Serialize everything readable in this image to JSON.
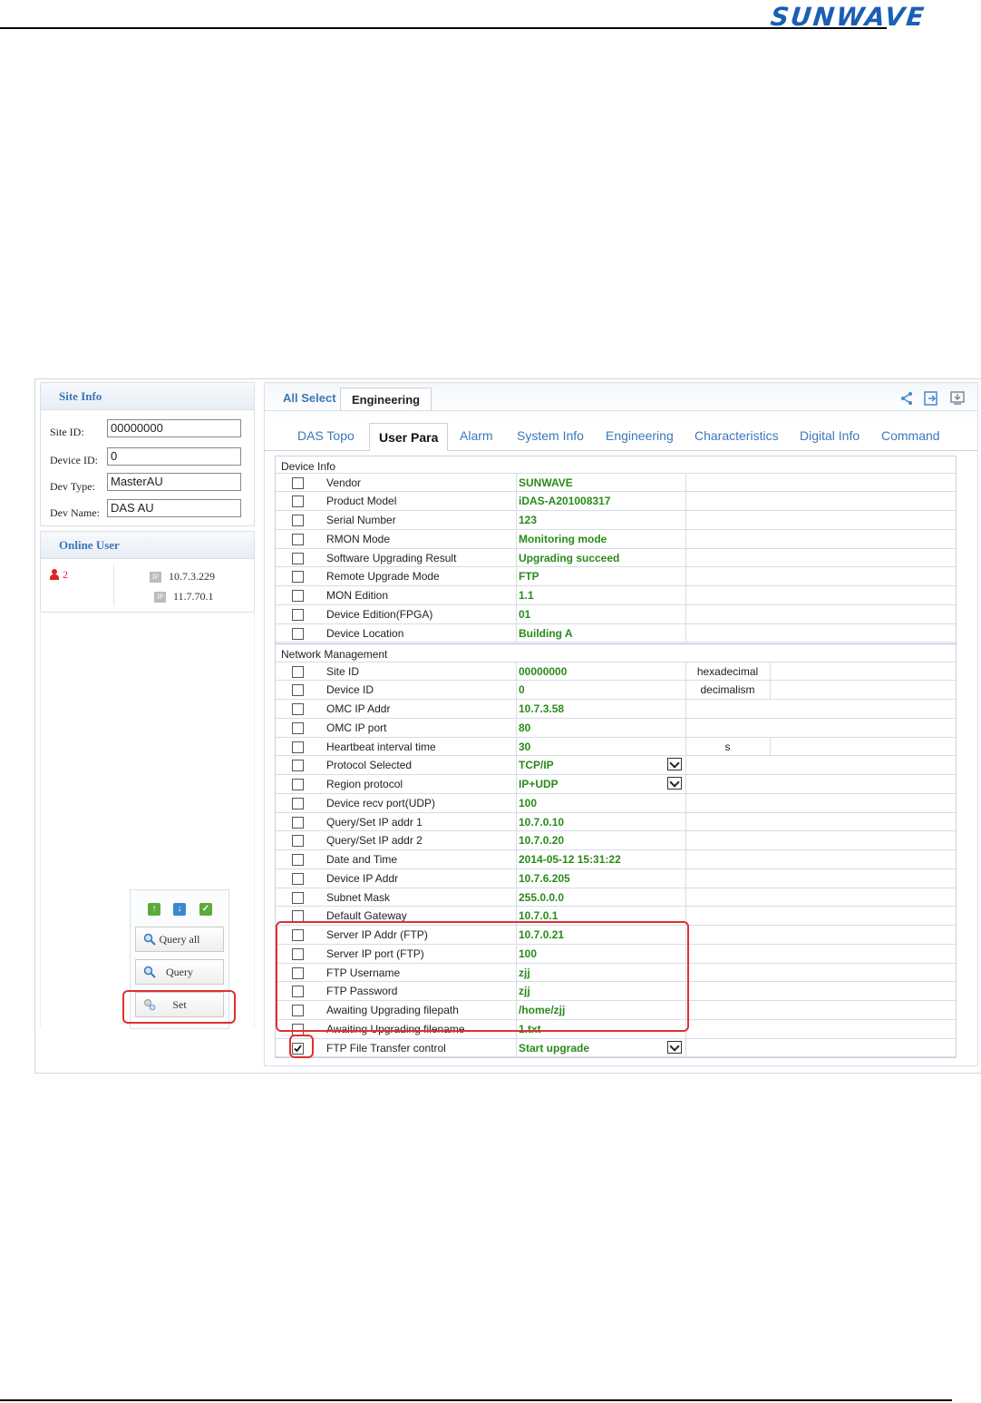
{
  "brand": {
    "logo": "SUNWAVE"
  },
  "site_info": {
    "title": "Site Info",
    "fields": [
      {
        "label": "Site ID:",
        "value": "00000000"
      },
      {
        "label": "Device ID:",
        "value": "0"
      },
      {
        "label": "Dev Type:",
        "value": "MasterAU"
      },
      {
        "label": "Dev Name:",
        "value": "DAS AU"
      }
    ]
  },
  "online_user": {
    "title": "Online User",
    "count": "2",
    "ips": [
      "10.7.3.229",
      "11.7.70.1"
    ],
    "ip_badge": "IP"
  },
  "actions": {
    "query_all": "Query all",
    "query": "Query",
    "set": "Set"
  },
  "top_tabs": {
    "select_all": "All Select",
    "engineering": "Engineering"
  },
  "sub_tabs": [
    "DAS Topo",
    "User Para",
    "Alarm",
    "System Info",
    "Engineering",
    "Characteristics",
    "Digital Info",
    "Command"
  ],
  "active_sub_tab": "User Para",
  "sections": {
    "device_info": "Device Info",
    "network_management": "Network Management"
  },
  "device_info_rows": [
    {
      "name": "Vendor",
      "value": "SUNWAVE"
    },
    {
      "name": "Product Model",
      "value": "iDAS-A201008317"
    },
    {
      "name": "Serial Number",
      "value": "123"
    },
    {
      "name": "RMON Mode",
      "value": "Monitoring mode"
    },
    {
      "name": "Software Upgrading Result",
      "value": "Upgrading succeed"
    },
    {
      "name": "Remote Upgrade Mode",
      "value": "FTP"
    },
    {
      "name": "MON Edition",
      "value": "1.1"
    },
    {
      "name": "Device Edition(FPGA)",
      "value": "01"
    },
    {
      "name": "Device Location",
      "value": "Building A"
    }
  ],
  "network_rows": [
    {
      "name": "Site ID",
      "value": "00000000",
      "unit": "hexadecimal"
    },
    {
      "name": "Device ID",
      "value": "0",
      "unit": "decimalism"
    },
    {
      "name": "OMC IP Addr",
      "value": "10.7.3.58"
    },
    {
      "name": "OMC IP port",
      "value": "80"
    },
    {
      "name": "Heartbeat interval time",
      "value": "30",
      "unit": "s"
    },
    {
      "name": "Protocol Selected",
      "value": "TCP/IP",
      "dropdown": true
    },
    {
      "name": "Region protocol",
      "value": "IP+UDP",
      "dropdown": true
    },
    {
      "name": "Device recv port(UDP)",
      "value": "100"
    },
    {
      "name": "Query/Set IP addr 1",
      "value": "10.7.0.10"
    },
    {
      "name": "Query/Set IP addr 2",
      "value": "10.7.0.20"
    },
    {
      "name": "Date and Time",
      "value": "2014-05-12 15:31:22"
    },
    {
      "name": "Device IP Addr",
      "value": "10.7.6.205"
    },
    {
      "name": "Subnet Mask",
      "value": "255.0.0.0"
    },
    {
      "name": "Default Gateway",
      "value": "10.7.0.1"
    },
    {
      "name": "Server IP Addr (FTP)",
      "value": "10.7.0.21"
    },
    {
      "name": "Server IP port (FTP)",
      "value": "100"
    },
    {
      "name": "FTP Username",
      "value": "zjj"
    },
    {
      "name": "FTP Password",
      "value": "zjj"
    },
    {
      "name": "Awaiting Upgrading filepath",
      "value": "/home/zjj"
    },
    {
      "name": "Awaiting Upgrading filename",
      "value": "1.txt"
    },
    {
      "name": "FTP File Transfer control",
      "value": "Start upgrade",
      "dropdown": true,
      "checked": true
    }
  ],
  "colors": {
    "accent": "#3a78b8",
    "value_green": "#2a8a1a",
    "highlight_red": "#e03030",
    "logo_blue": "#1a5fb4"
  }
}
